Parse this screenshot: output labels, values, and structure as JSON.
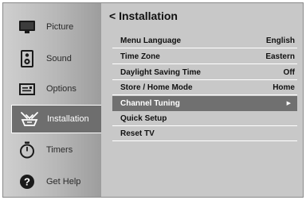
{
  "sidebar": {
    "items": [
      {
        "label": "Picture",
        "icon": "tv-icon"
      },
      {
        "label": "Sound",
        "icon": "speaker-icon"
      },
      {
        "label": "Options",
        "icon": "options-icon"
      },
      {
        "label": "Installation",
        "icon": "antenna-icon",
        "active": true
      },
      {
        "label": "Timers",
        "icon": "timer-icon"
      },
      {
        "label": "Get Help",
        "icon": "help-icon"
      }
    ]
  },
  "main": {
    "title": "< Installation",
    "rows": [
      {
        "label": "Menu Language",
        "value": "English"
      },
      {
        "label": "Time Zone",
        "value": "Eastern"
      },
      {
        "label": "Daylight Saving Time",
        "value": "Off"
      },
      {
        "label": "Store / Home Mode",
        "value": "Home"
      },
      {
        "label": "Channel Tuning",
        "value": "",
        "arrow": "▶",
        "selected": true
      },
      {
        "label": "Quick Setup",
        "value": ""
      },
      {
        "label": "Reset TV",
        "value": ""
      }
    ]
  },
  "colors": {
    "sidebar_active": "#6e6e6e",
    "row_selected": "#707070",
    "panel": "#c8c8c8"
  }
}
